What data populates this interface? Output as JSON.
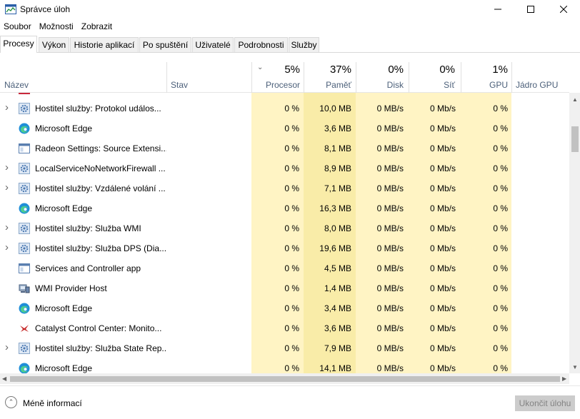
{
  "window": {
    "title": "Správce úloh"
  },
  "menu": [
    "Soubor",
    "Možnosti",
    "Zobrazit"
  ],
  "tabs": [
    "Procesy",
    "Výkon",
    "Historie aplikací",
    "Po spuštění",
    "Uživatelé",
    "Podrobnosti",
    "Služby"
  ],
  "columns": {
    "name": "Název",
    "status": "Stav",
    "cpu": {
      "label": "Procesor",
      "pct": "5%"
    },
    "memory": {
      "label": "Paměť",
      "pct": "37%"
    },
    "disk": {
      "label": "Disk",
      "pct": "0%"
    },
    "network": {
      "label": "Síť",
      "pct": "0%"
    },
    "gpu": {
      "label": "GPU",
      "pct": "1%"
    },
    "gpu_engine": "Jádro GPU"
  },
  "rows": [
    {
      "name": "Hostitel služby: Protokol událos...",
      "icon": "gear-icon",
      "expandable": true,
      "cpu": "0 %",
      "memory": "10,0 MB",
      "disk": "0 MB/s",
      "network": "0 Mb/s",
      "gpu": "0 %"
    },
    {
      "name": "Microsoft Edge",
      "icon": "edge-icon",
      "expandable": false,
      "cpu": "0 %",
      "memory": "3,6 MB",
      "disk": "0 MB/s",
      "network": "0 Mb/s",
      "gpu": "0 %"
    },
    {
      "name": "Radeon Settings: Source Extensi...",
      "icon": "app-window-icon",
      "expandable": false,
      "cpu": "0 %",
      "memory": "8,1 MB",
      "disk": "0 MB/s",
      "network": "0 Mb/s",
      "gpu": "0 %"
    },
    {
      "name": "LocalServiceNoNetworkFirewall ...",
      "icon": "gear-icon",
      "expandable": true,
      "cpu": "0 %",
      "memory": "8,9 MB",
      "disk": "0 MB/s",
      "network": "0 Mb/s",
      "gpu": "0 %"
    },
    {
      "name": "Hostitel služby: Vzdálené volání ...",
      "icon": "gear-icon",
      "expandable": true,
      "cpu": "0 %",
      "memory": "7,1 MB",
      "disk": "0 MB/s",
      "network": "0 Mb/s",
      "gpu": "0 %"
    },
    {
      "name": "Microsoft Edge",
      "icon": "edge-icon",
      "expandable": false,
      "cpu": "0 %",
      "memory": "16,3 MB",
      "disk": "0 MB/s",
      "network": "0 Mb/s",
      "gpu": "0 %"
    },
    {
      "name": "Hostitel služby: Služba WMI",
      "icon": "gear-icon",
      "expandable": true,
      "cpu": "0 %",
      "memory": "8,0 MB",
      "disk": "0 MB/s",
      "network": "0 Mb/s",
      "gpu": "0 %"
    },
    {
      "name": "Hostitel služby: Služba DPS (Dia...",
      "icon": "gear-icon",
      "expandable": true,
      "cpu": "0 %",
      "memory": "19,6 MB",
      "disk": "0 MB/s",
      "network": "0 Mb/s",
      "gpu": "0 %"
    },
    {
      "name": "Services and Controller app",
      "icon": "app-window-icon",
      "expandable": false,
      "cpu": "0 %",
      "memory": "4,5 MB",
      "disk": "0 MB/s",
      "network": "0 Mb/s",
      "gpu": "0 %"
    },
    {
      "name": "WMI Provider Host",
      "icon": "wmi-host-icon",
      "expandable": false,
      "cpu": "0 %",
      "memory": "1,4 MB",
      "disk": "0 MB/s",
      "network": "0 Mb/s",
      "gpu": "0 %"
    },
    {
      "name": "Microsoft Edge",
      "icon": "edge-icon",
      "expandable": false,
      "cpu": "0 %",
      "memory": "3,4 MB",
      "disk": "0 MB/s",
      "network": "0 Mb/s",
      "gpu": "0 %"
    },
    {
      "name": "Catalyst Control Center: Monito...",
      "icon": "catalyst-icon",
      "expandable": false,
      "cpu": "0 %",
      "memory": "3,6 MB",
      "disk": "0 MB/s",
      "network": "0 Mb/s",
      "gpu": "0 %"
    },
    {
      "name": "Hostitel služby: Služba State Rep...",
      "icon": "gear-icon",
      "expandable": true,
      "cpu": "0 %",
      "memory": "7,9 MB",
      "disk": "0 MB/s",
      "network": "0 Mb/s",
      "gpu": "0 %"
    },
    {
      "name": "Microsoft Edge",
      "icon": "edge-icon",
      "expandable": false,
      "cpu": "0 %",
      "memory": "14,1 MB",
      "disk": "0 MB/s",
      "network": "0 Mb/s",
      "gpu": "0 %"
    }
  ],
  "footer": {
    "less_info": "Méně informací",
    "end_task": "Ukončit úlohu"
  },
  "colors": {
    "cell_light": "#fff4c4",
    "cell_dark": "#f9eca8",
    "header_text": "#4c607a"
  }
}
